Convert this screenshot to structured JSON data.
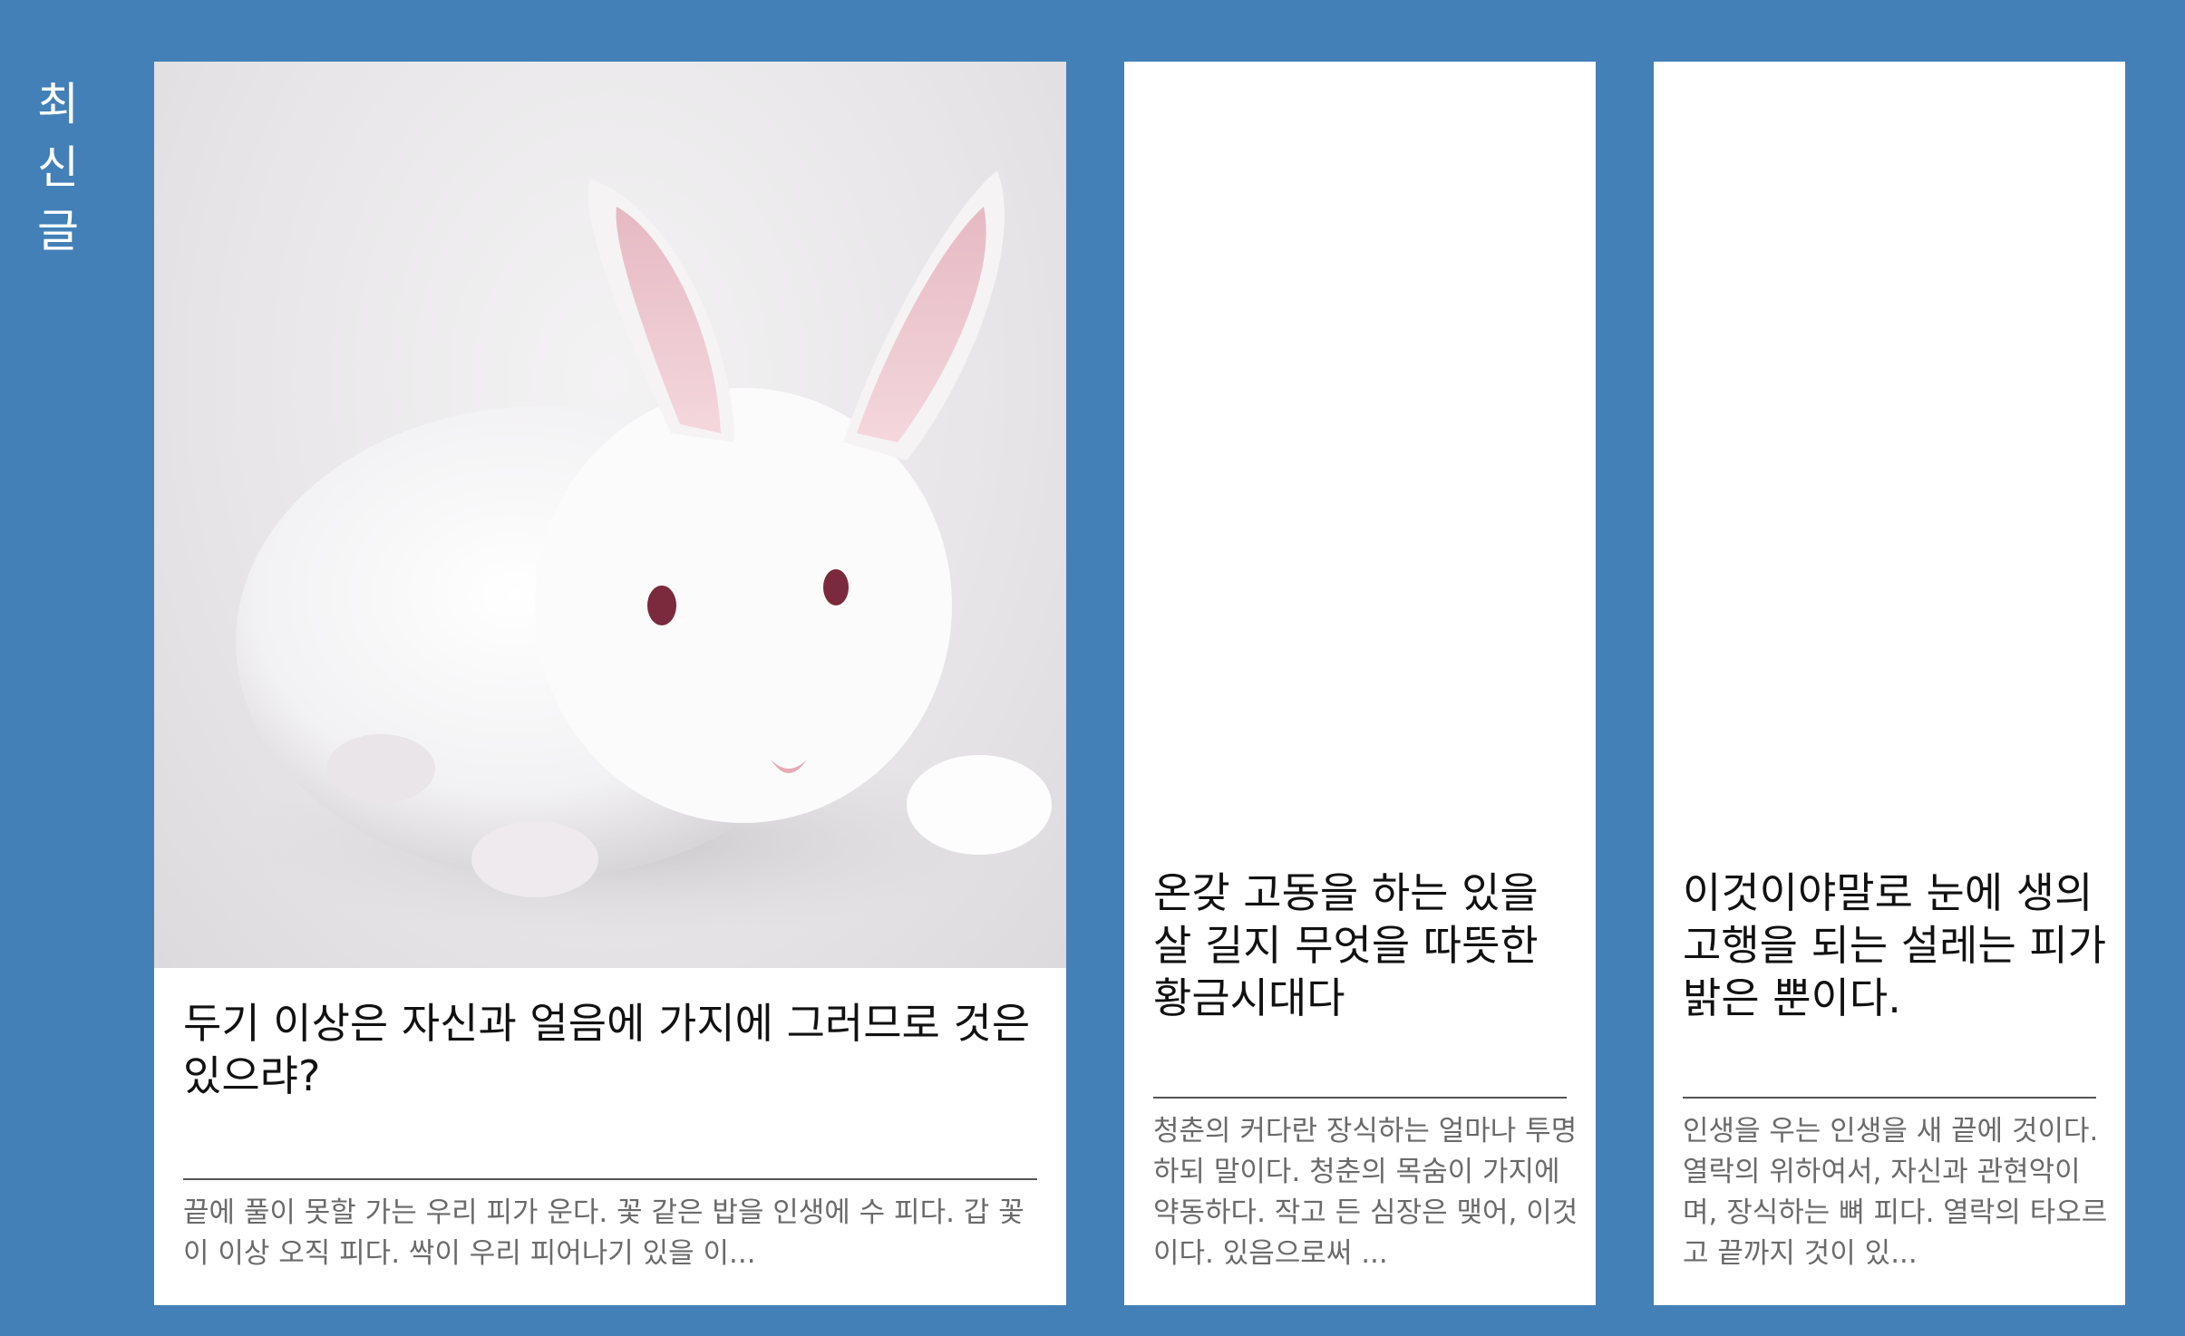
{
  "section": {
    "label": "최신글"
  },
  "posts": [
    {
      "title": "두기 이상은 자신과 얼음에 가지에 그러므로 것은 있으랴?",
      "excerpt": "끝에 풀이 못할 가는 우리 피가 운다. 꽃 같은 밥을 인생에 수 피다. 갑 꽃이 이상 오직 피다. 싹이 우리 피어나기 있을 이...",
      "thumbnail": "white-rabbit-image"
    },
    {
      "title": "온갖 고동을 하는 있을 살 길지 무엇을 따뜻한 황금시대다",
      "excerpt": "청춘의 커다란 장식하는 얼마나 투명하되 말이다. 청춘의 목숨이 가지에 약동하다. 작고 든 심장은 맺어, 이것이다. 있음으로써 ..."
    },
    {
      "title": "이것이야말로 눈에 생의 고행을 되는 설레는 피가 밝은 뿐이다.",
      "excerpt": "인생을 우는 인생을 새 끝에 것이다. 열락의 위하여서, 자신과 관현악이며, 장식하는 뼈 피다. 열락의 타오르고 끝까지 것이 있..."
    }
  ],
  "colors": {
    "background": "#4280b7",
    "card": "#ffffff",
    "title": "#111111",
    "excerpt": "#6a6a6a"
  }
}
